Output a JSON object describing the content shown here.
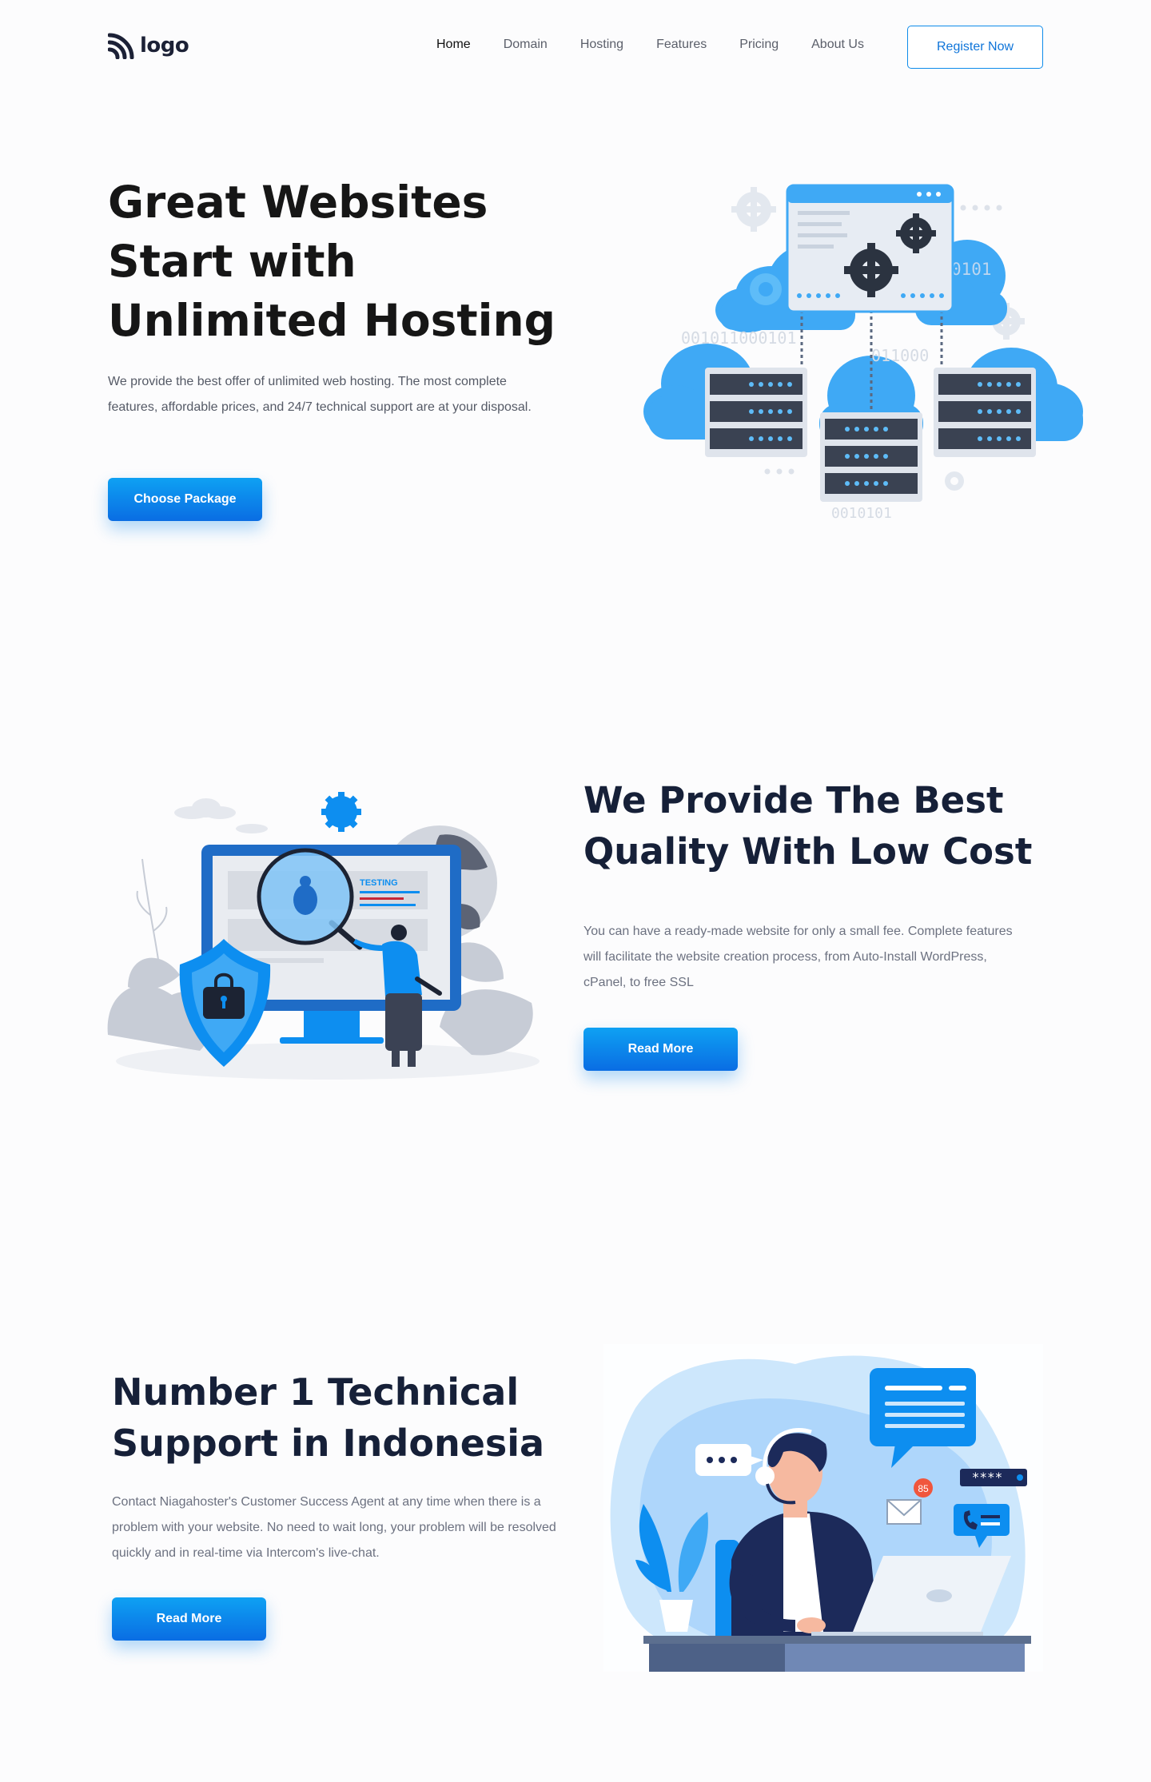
{
  "nav": {
    "logo_text": "logo",
    "items": [
      {
        "label": "Home",
        "active": true
      },
      {
        "label": "Domain"
      },
      {
        "label": "Hosting"
      },
      {
        "label": "Features"
      },
      {
        "label": "Pricing"
      },
      {
        "label": "About Us"
      }
    ],
    "register_label": "Register Now"
  },
  "hero": {
    "title": "Great Websites Start with Unlimited Hosting",
    "description": "We provide the best offer of unlimited web hosting. The most complete features, affordable prices, and 24/7 technical support are at your disposal.",
    "cta_label": "Choose Package",
    "illustration_binary_labels": [
      "0101",
      "001011000101",
      "011000",
      "0010101"
    ]
  },
  "quality": {
    "title": "We Provide The Best Quality With Low Cost",
    "description": "You can have a ready-made website for only a small fee. Complete features will facilitate the website creation process, from Auto-Install WordPress, cPanel, to free SSL",
    "cta_label": "Read More",
    "illustration_screen_label": "TESTING"
  },
  "support": {
    "title": "Number 1 Technical Support in Indonesia",
    "description": "Contact Niagahoster's Customer Success Agent at any time when there is a problem with your website. No need to wait long, your problem will be resolved quickly and in real-time via Intercom's live-chat.",
    "cta_label": "Read More",
    "illustration_badge": "85",
    "illustration_password": "****"
  },
  "colors": {
    "primary": "#0a6de3",
    "primary_light": "#0ea1f3",
    "heading": "#162038",
    "illustration_blue": "#3fa9f5"
  }
}
